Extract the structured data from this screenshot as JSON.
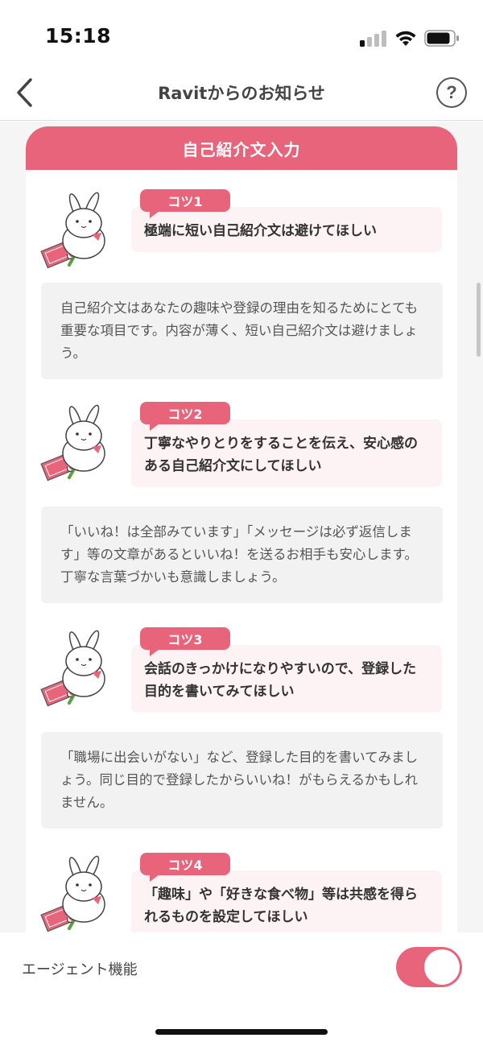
{
  "status_bar": {
    "time": "15:18"
  },
  "nav": {
    "title": "Ravitからのお知らせ",
    "help_symbol": "?"
  },
  "section": {
    "title": "自己紹介文入力"
  },
  "tips": [
    {
      "badge": "コツ1",
      "title": "極端に短い自己紹介文は避けてほしい",
      "description": "自己紹介文はあなたの趣味や登録の理由を知るためにとても重要な項目です。内容が薄く、短い自己紹介文は避けましょう。"
    },
    {
      "badge": "コツ2",
      "title": "丁寧なやりとりをすることを伝え、安心感のある自己紹介文にしてほしい",
      "description": "「いいね！は全部みています」「メッセージは必ず返信します」等の文章があるといいね！を送るお相手も安心します。丁寧な言葉づかいも意識しましょう。"
    },
    {
      "badge": "コツ3",
      "title": "会話のきっかけになりやすいので、登録した目的を書いてみてほしい",
      "description": "「職場に出会いがない」など、登録した目的を書いてみましょう。同じ目的で登録したからいいね！がもらえるかもしれません。"
    },
    {
      "badge": "コツ4",
      "title": "「趣味」や「好きな食べ物」等は共感を得られるものを設定してほしい",
      "description": ""
    }
  ],
  "agent": {
    "label": "エージェント機能",
    "enabled": true
  },
  "colors": {
    "accent": "#e8647a",
    "tip_title_bg": "#fdf2f4",
    "desc_bg": "#f2f2f2"
  },
  "icons": {
    "back": "chevron-left-icon",
    "help": "question-circle-icon",
    "tip_illustration": "rabbit-with-notebook-illustration"
  }
}
